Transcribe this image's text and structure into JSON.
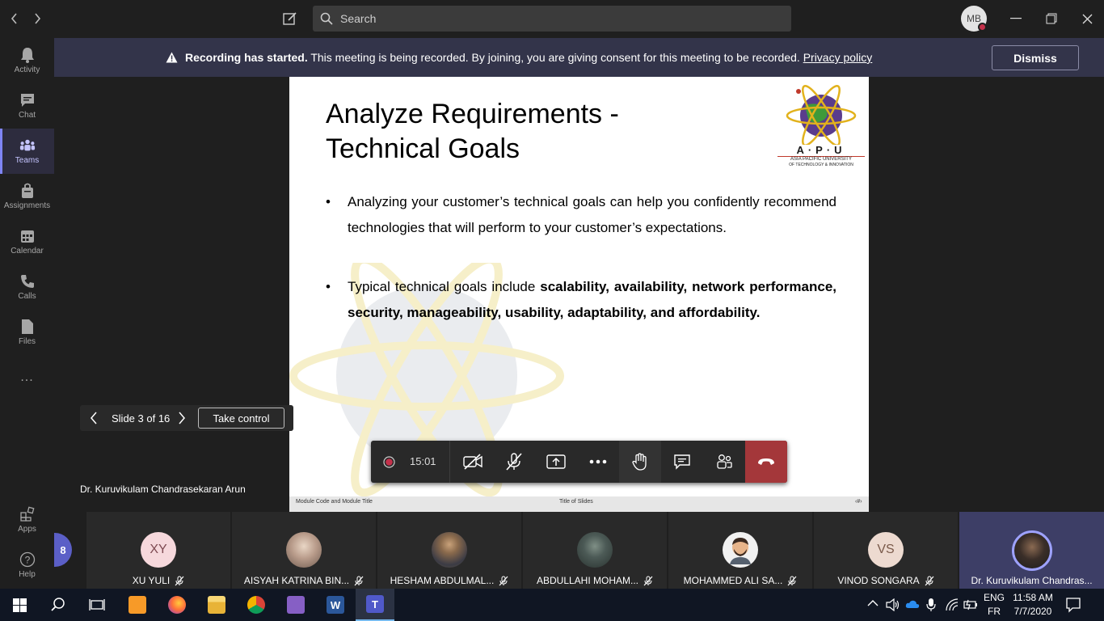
{
  "titlebar": {
    "search_placeholder": "Search",
    "avatar_initials": "MB"
  },
  "rail": {
    "items": [
      {
        "label": "Activity",
        "icon": "bell-icon"
      },
      {
        "label": "Chat",
        "icon": "chat-icon"
      },
      {
        "label": "Teams",
        "icon": "teams-icon",
        "active": true
      },
      {
        "label": "Assignments",
        "icon": "assignments-icon"
      },
      {
        "label": "Calendar",
        "icon": "calendar-icon"
      },
      {
        "label": "Calls",
        "icon": "phone-icon"
      },
      {
        "label": "Files",
        "icon": "file-icon"
      }
    ],
    "more_label": "...",
    "bottom": [
      {
        "label": "Apps",
        "icon": "apps-icon"
      },
      {
        "label": "Help",
        "icon": "help-icon"
      }
    ]
  },
  "banner": {
    "bold": "Recording has started.",
    "text": " This meeting is being recorded. By joining, you are giving consent for this meeting to be recorded. ",
    "link": "Privacy policy",
    "dismiss_label": "Dismiss"
  },
  "slide": {
    "title_line1": "Analyze Requirements -",
    "title_line2": "Technical Goals",
    "logo_text": "A·P·U",
    "logo_sub1": "ASIA PACIFIC UNIVERSITY",
    "logo_sub2": "OF TECHNOLOGY & INNOVATION",
    "bullet1": "Analyzing your customer’s technical goals can help you confidently recommend technologies that will perform to your customer’s expectations.",
    "bullet2_prefix": "Typical technical goals include ",
    "bullet2_bold": "scalability, availability, network performance, security, manageability, usability, adaptability, and affordability",
    "bullet2_suffix": ".",
    "footer_left": "Module Code and Module Title",
    "footer_center": "Title of Slides",
    "footer_right": "‹#›"
  },
  "slide_nav": {
    "counter": "Slide 3 of 16",
    "take_control_label": "Take control"
  },
  "controls": {
    "timer": "15:01"
  },
  "presenter_name": "Dr. Kuruvikulam Chandrasekaran Arun",
  "participants": {
    "overflow_count": "8",
    "tiles": [
      {
        "name": "XU YULI",
        "initials": "XY",
        "color": "#f6d8dc"
      },
      {
        "name": "AISYAH KATRINA BIN...",
        "initials": "",
        "color": "#b89b8a"
      },
      {
        "name": "HESHAM ABDULMAL...",
        "initials": "",
        "color": "#6a5a48"
      },
      {
        "name": "ABDULLAHI MOHAM...",
        "initials": "",
        "color": "#4c5a56"
      },
      {
        "name": "MOHAMMED ALI SA...",
        "initials": "",
        "color": "#f1f1f1"
      },
      {
        "name": "VINOD SONGARA",
        "initials": "VS",
        "color": "#eddad0"
      },
      {
        "name": "Dr. Kuruvikulam Chandras...",
        "initials": "",
        "color": "#3a3a3a"
      }
    ]
  },
  "taskbar": {
    "lang1": "ENG",
    "lang2": "FR",
    "time": "11:58 AM",
    "date": "7/7/2020"
  }
}
